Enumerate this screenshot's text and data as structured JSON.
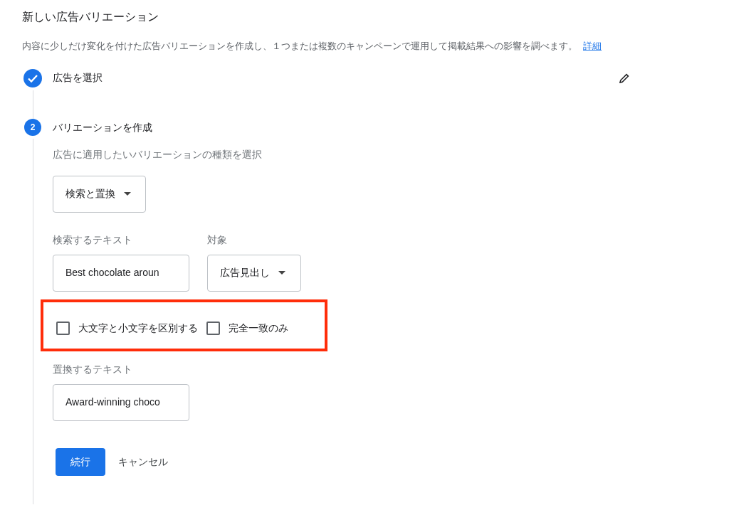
{
  "title": "新しい広告バリエーション",
  "description": "内容に少しだけ変化を付けた広告バリエーションを作成し、１つまたは複数のキャンペーンで運用して掲載結果への影響を調べます。",
  "description_link": "詳細",
  "steps": [
    {
      "completed": true,
      "label": "広告を選択",
      "editable": true
    },
    {
      "completed": false,
      "number": "2",
      "label": "バリエーションを作成",
      "editable": false
    }
  ],
  "variation_type": {
    "label": "広告に適用したいバリエーションの種類を選択",
    "value": "検索と置換"
  },
  "search_text": {
    "label": "検索するテキスト",
    "value": "Best chocolate aroun"
  },
  "target": {
    "label": "対象",
    "value": "広告見出し"
  },
  "options": [
    {
      "label": "大文字と小文字を区別する",
      "checked": false
    },
    {
      "label": "完全一致のみ",
      "checked": false
    }
  ],
  "highlight": true,
  "replace_text": {
    "label": "置換するテキスト",
    "value": "Award-winning choco"
  },
  "buttons": {
    "primary": "続行",
    "secondary": "キャンセル"
  }
}
